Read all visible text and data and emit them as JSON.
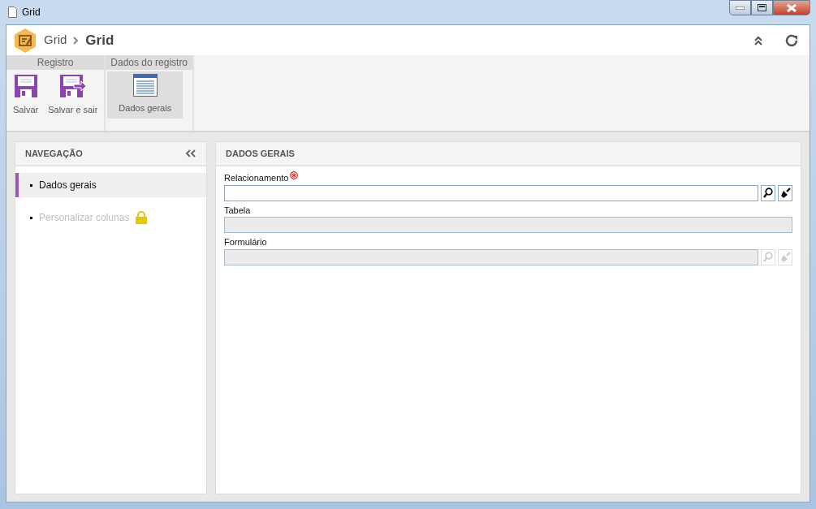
{
  "window": {
    "title": "Grid"
  },
  "breadcrumb": {
    "parent": "Grid",
    "current": "Grid"
  },
  "toolbar_groups": [
    {
      "title": "Registro",
      "buttons": [
        {
          "label": "Salvar",
          "kind": "save",
          "selected": false
        },
        {
          "label": "Salvar e sair",
          "kind": "exit",
          "selected": false
        }
      ]
    },
    {
      "title": "Dados do registro",
      "buttons": [
        {
          "label": "Dados gerais",
          "kind": "form",
          "selected": true
        }
      ]
    }
  ],
  "navigation": {
    "title": "NAVEGAÇÃO",
    "items": [
      {
        "label": "Dados gerais",
        "selected": true,
        "locked": false
      },
      {
        "label": "Personalizar colunas",
        "selected": false,
        "locked": true
      }
    ]
  },
  "panel": {
    "title": "DADOS GERAIS",
    "fields": [
      {
        "label": "Relacionamento",
        "kind": "lookup",
        "required": true,
        "disabled": false
      },
      {
        "label": "Tabela",
        "kind": "text",
        "required": false,
        "disabled": true
      },
      {
        "label": "Formulário",
        "kind": "lookup",
        "required": false,
        "disabled": true
      }
    ]
  }
}
